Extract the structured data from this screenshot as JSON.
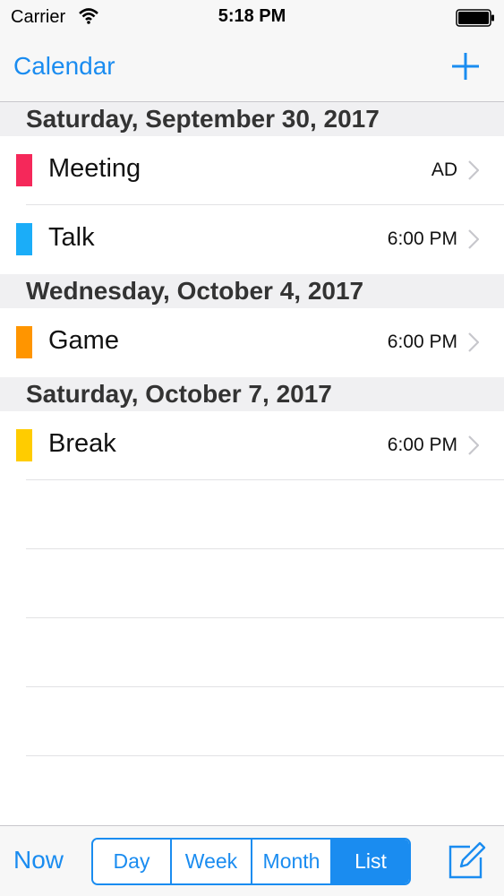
{
  "status_bar": {
    "carrier": "Carrier",
    "time": "5:18 PM",
    "icons": [
      "wifi-icon",
      "battery-icon"
    ]
  },
  "nav": {
    "back_label": "Calendar",
    "add_icon": "plus-icon"
  },
  "sections": [
    {
      "header": "Saturday, September 30, 2017",
      "events": [
        {
          "title": "Meeting",
          "time": "AD",
          "color": "#f5285a"
        },
        {
          "title": "Talk",
          "time": "6:00 PM",
          "color": "#1badf8"
        }
      ]
    },
    {
      "header": "Wednesday, October 4, 2017",
      "events": [
        {
          "title": "Game",
          "time": "6:00 PM",
          "color": "#ff9500"
        }
      ]
    },
    {
      "header": "Saturday, October 7, 2017",
      "events": [
        {
          "title": "Break",
          "time": "6:00 PM",
          "color": "#ffcc00"
        }
      ]
    }
  ],
  "toolbar": {
    "now_label": "Now",
    "segments": [
      "Day",
      "Week",
      "Month",
      "List"
    ],
    "selected_segment": "List",
    "compose_icon": "compose-icon"
  },
  "colors": {
    "accent": "#1a8cf0"
  }
}
